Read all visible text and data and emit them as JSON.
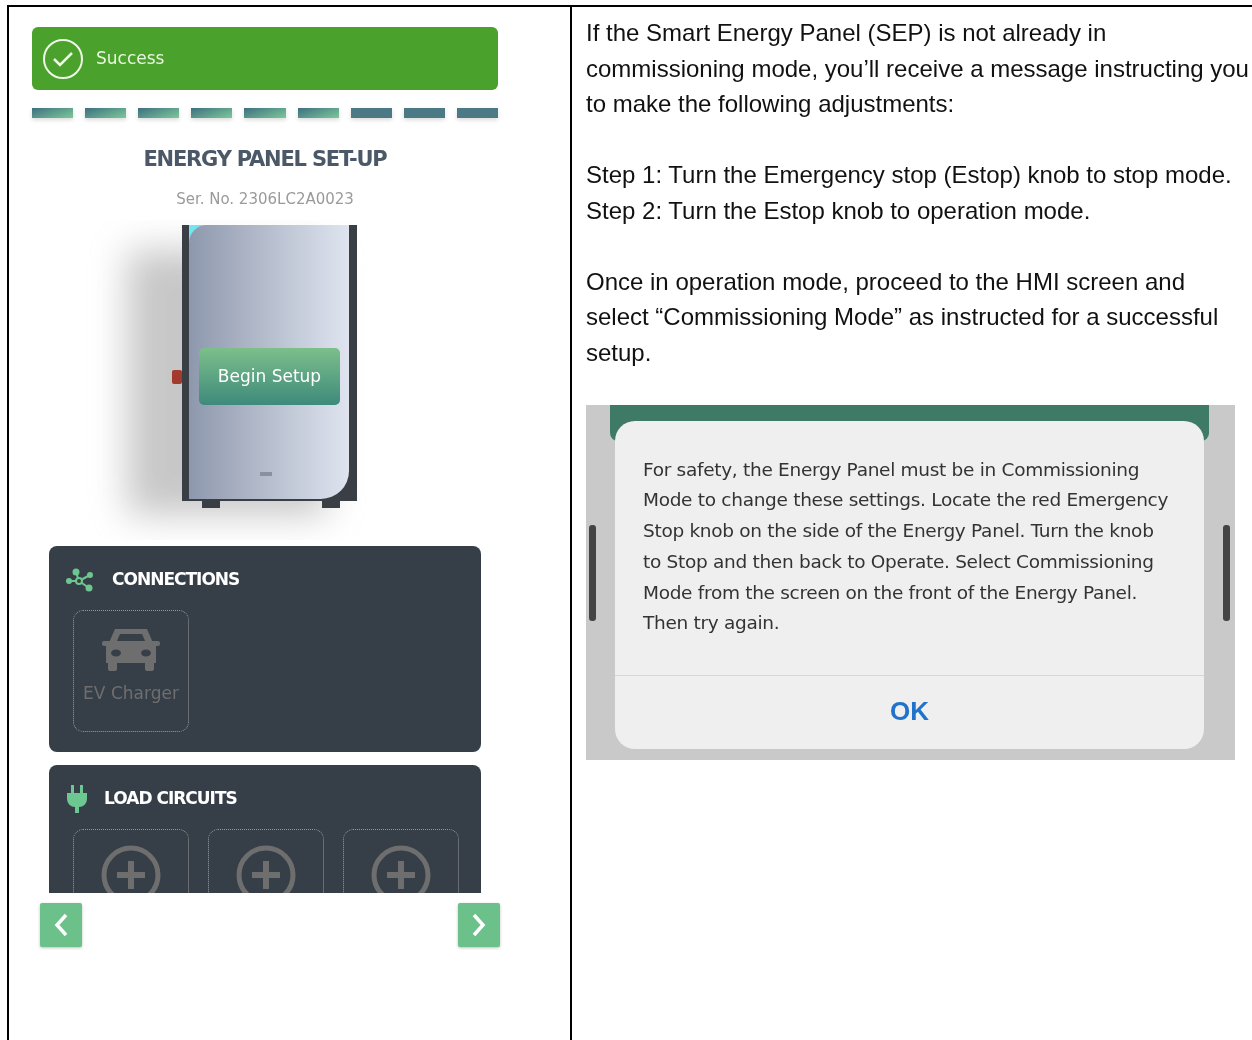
{
  "app": {
    "toast": {
      "kind": "success",
      "text": "Success"
    },
    "progress": [
      {
        "done": true
      },
      {
        "done": true
      },
      {
        "done": true
      },
      {
        "done": true
      },
      {
        "done": true
      },
      {
        "done": true
      },
      {
        "done": false
      },
      {
        "done": false
      },
      {
        "done": false
      }
    ],
    "title": "ENERGY PANEL SET-UP",
    "serial": "Ser. No. 2306LC2A0023",
    "begin_button": "Begin Setup",
    "sections": [
      {
        "kind": "connections",
        "title": "CONNECTIONS",
        "tiles": [
          {
            "kind": "ev",
            "label": "EV Charger"
          }
        ]
      },
      {
        "kind": "load",
        "title": "LOAD CIRCUITS",
        "tiles": [
          {
            "kind": "add"
          },
          {
            "kind": "add"
          },
          {
            "kind": "add"
          }
        ]
      }
    ]
  },
  "instructions": [
    [
      "If the Smart Energy Panel (SEP) is not already in commissioning mode, you’ll receive a message instructing you to make the following adjustments:"
    ],
    [
      "Step 1: Turn the Emergency stop (Estop) knob to stop mode.",
      "Step 2: Turn the Estop knob to operation mode."
    ],
    [
      "Once in operation mode, proceed to the HMI screen and select “Commissioning Mode” as instructed for a successful setup."
    ]
  ],
  "dialog": {
    "message": "For safety, the Energy Panel must be in Commissioning Mode to change these settings. Locate the red Emergency Stop knob on the side of the Energy Panel. Turn the knob to Stop and then back to Operate. Select Commissioning Mode from the screen on the front of the Energy Panel. Then try again.",
    "button": "OK"
  }
}
